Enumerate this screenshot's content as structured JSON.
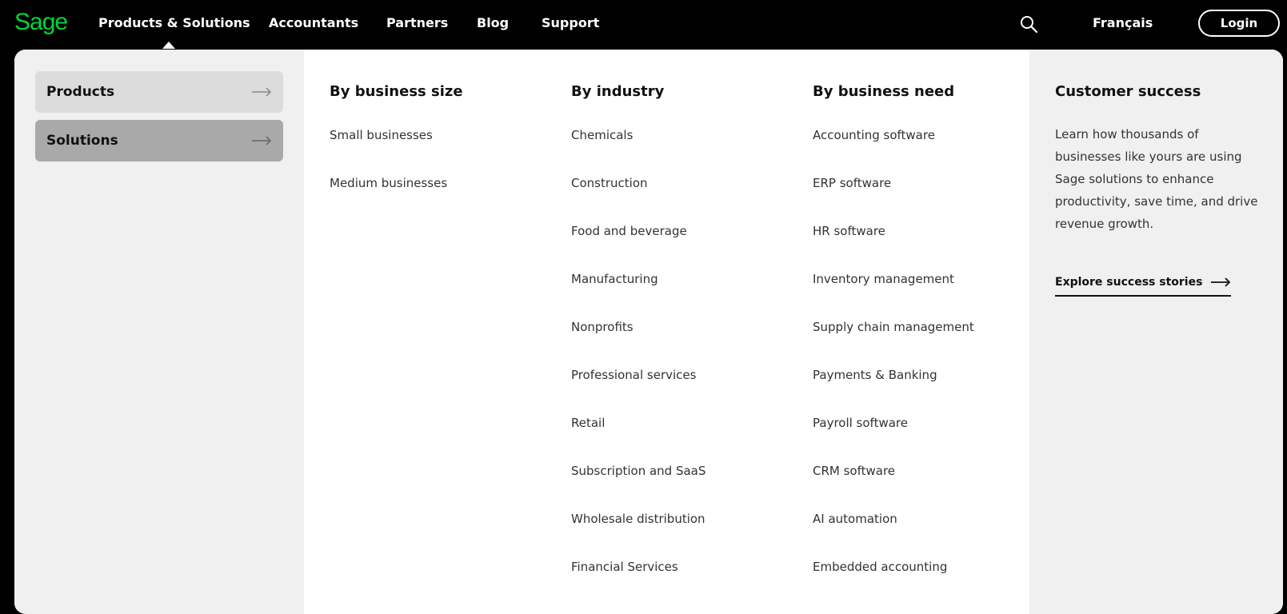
{
  "nav": {
    "logo": "Sage",
    "links": [
      "Products & Solutions",
      "Accountants",
      "Partners",
      "Blog",
      "Support"
    ],
    "language": "Français",
    "login": "Login",
    "search_icon": "search-icon"
  },
  "menu": {
    "tabs": [
      {
        "label": "Products",
        "icon": "arrow-right-icon"
      },
      {
        "label": "Solutions",
        "icon": "arrow-right-icon"
      }
    ],
    "columns": [
      {
        "heading": "By business size",
        "items": [
          "Small businesses",
          "Medium businesses"
        ]
      },
      {
        "heading": "By industry",
        "items": [
          "Chemicals",
          "Construction",
          "Food and beverage",
          "Manufacturing",
          "Nonprofits",
          "Professional services",
          "Retail",
          "Subscription and SaaS",
          "Wholesale distribution",
          "Financial Services"
        ]
      },
      {
        "heading": "By business need",
        "items": [
          "Accounting software",
          "ERP software",
          "HR software",
          "Inventory management",
          "Supply chain management",
          "Payments & Banking",
          "Payroll software",
          "CRM software",
          "AI automation",
          "Embedded accounting"
        ]
      }
    ],
    "customer_success": {
      "title": "Customer success",
      "text": "Learn how thousands of businesses like yours are using Sage solutions to enhance productivity, save time, and drive revenue growth.",
      "link": "Explore success stories"
    }
  },
  "colors": {
    "brand": "#00d639",
    "nav_bg": "#000000",
    "panel_bg": "#f0f0f0",
    "active_tab": "#a9a9a9"
  }
}
